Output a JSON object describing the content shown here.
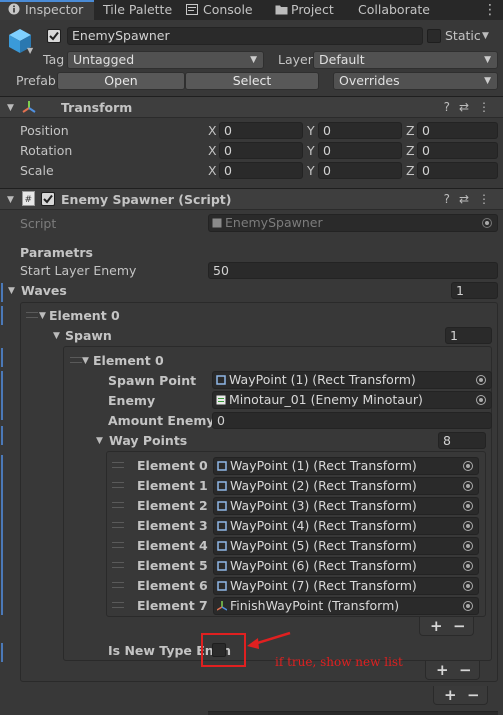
{
  "tabs": [
    {
      "label": "Inspector",
      "icon": "info-icon",
      "active": true
    },
    {
      "label": "Tile Palette",
      "icon": "",
      "active": false
    },
    {
      "label": "Console",
      "icon": "console-icon",
      "active": false
    },
    {
      "label": "Project",
      "icon": "folder-icon",
      "active": false
    },
    {
      "label": "Collaborate",
      "icon": "",
      "active": false
    }
  ],
  "gameobject": {
    "active": true,
    "name": "EnemySpawner",
    "static_label": "Static",
    "tag_label": "Tag",
    "tag_value": "Untagged",
    "layer_label": "Layer",
    "layer_value": "Default",
    "prefab_label": "Prefab",
    "open_label": "Open",
    "select_label": "Select",
    "overrides_label": "Overrides"
  },
  "transform": {
    "title": "Transform",
    "rows": [
      {
        "label": "Position",
        "x": "0",
        "y": "0",
        "z": "0"
      },
      {
        "label": "Rotation",
        "x": "0",
        "y": "0",
        "z": "0"
      },
      {
        "label": "Scale",
        "x": "0",
        "y": "0",
        "z": "0"
      }
    ],
    "axis_x": "X",
    "axis_y": "Y",
    "axis_z": "Z"
  },
  "script_component": {
    "title": "Enemy Spawner (Script)",
    "enabled": true,
    "script_label": "Script",
    "script_value": "EnemySpawner",
    "section_header": "Parametrs",
    "start_layer_label": "Start Layer Enemy",
    "start_layer_value": "50",
    "waves_label": "Waves",
    "waves_count": "1",
    "element0_label": "Element 0",
    "spawn_label": "Spawn",
    "spawn_count": "1",
    "spawn_element_label": "Element 0",
    "spawn_point_label": "Spawn Point",
    "spawn_point_value": "WayPoint (1) (Rect Transform)",
    "enemy_label": "Enemy",
    "enemy_value": "Minotaur_01 (Enemy Minotaur)",
    "amount_label": "Amount Enemy",
    "amount_value": "0",
    "waypoints_label": "Way Points",
    "waypoints_count": "8",
    "waypoints": [
      {
        "label": "Element 0",
        "value": "WayPoint (1) (Rect Transform)"
      },
      {
        "label": "Element 1",
        "value": "WayPoint (2) (Rect Transform)"
      },
      {
        "label": "Element 2",
        "value": "WayPoint (3) (Rect Transform)"
      },
      {
        "label": "Element 3",
        "value": "WayPoint (4) (Rect Transform)"
      },
      {
        "label": "Element 4",
        "value": "WayPoint (5) (Rect Transform)"
      },
      {
        "label": "Element 5",
        "value": "WayPoint (6) (Rect Transform)"
      },
      {
        "label": "Element 6",
        "value": "WayPoint (7) (Rect Transform)"
      },
      {
        "label": "Element 7",
        "value": "FinishWayPoint (Transform)"
      }
    ],
    "is_new_type_label": "Is New Type Enen",
    "is_new_type_checked": false
  },
  "annotation": {
    "text": "if true, show new list",
    "color": "#e02020"
  },
  "list_controls": {
    "add": "+",
    "remove": "−"
  },
  "colors": {
    "accent": "#4a8bd6",
    "annotation": "#e02020"
  }
}
